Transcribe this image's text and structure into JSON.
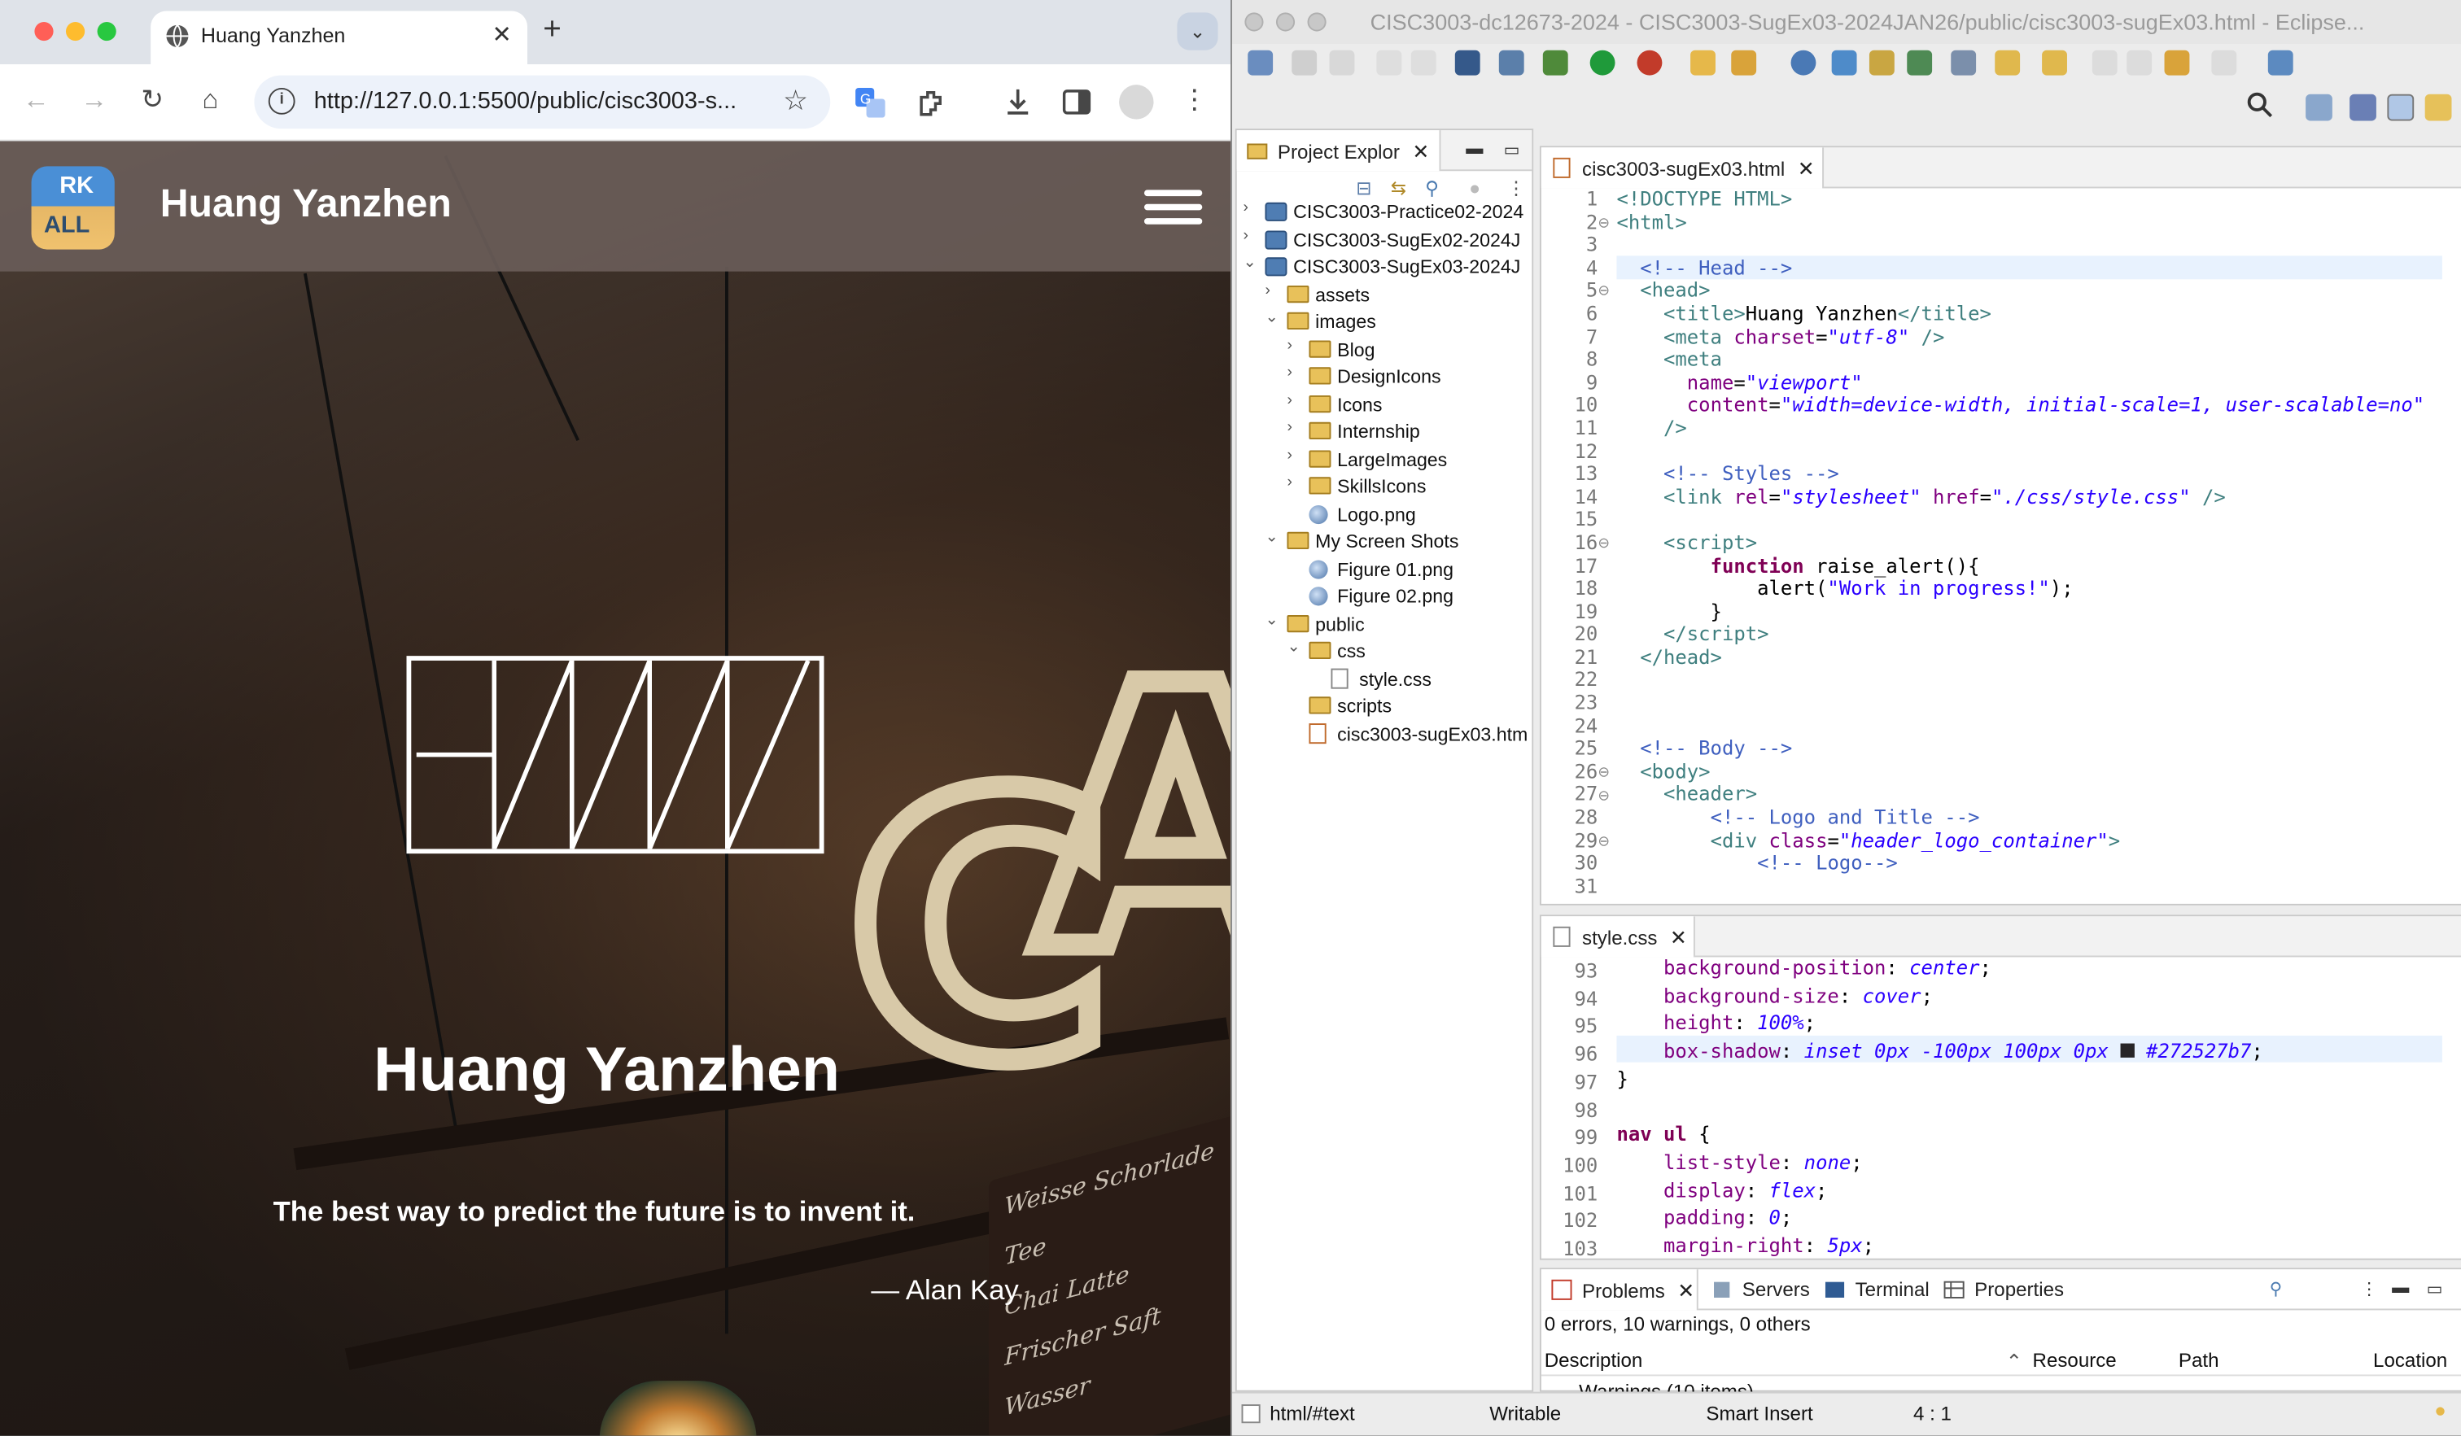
{
  "browser": {
    "tab_title": "Huang Yanzhen",
    "new_tab_symbol": "+",
    "url": "http://127.0.0.1:5500/public/cisc3003-s...",
    "page": {
      "site_title": "Huang Yanzhen",
      "logo_top": "RK",
      "logo_bottom": "ALL",
      "hero_name": "Huang Yanzhen",
      "quote": "The best way to predict the future is to invent it.",
      "author": "— Alan Kay"
    }
  },
  "eclipse": {
    "window_title": "CISC3003-dc12673-2024 - CISC3003-SugEx03-2024JAN26/public/cisc3003-sugEx03.html - Eclipse...",
    "explorer": {
      "tab_label": "Project Explor",
      "items": [
        {
          "label": "CISC3003-Practice02-2024",
          "kind": "project",
          "arrow": "›"
        },
        {
          "label": "CISC3003-SugEx02-2024J",
          "kind": "project",
          "arrow": "›"
        },
        {
          "label": "CISC3003-SugEx03-2024J",
          "kind": "project",
          "arrow": "⌄"
        },
        {
          "label": "assets",
          "kind": "folder",
          "arrow": "›"
        },
        {
          "label": "images",
          "kind": "folder",
          "arrow": "⌄"
        },
        {
          "label": "Blog",
          "kind": "folder",
          "arrow": "›"
        },
        {
          "label": "DesignIcons",
          "kind": "folder",
          "arrow": "›"
        },
        {
          "label": "Icons",
          "kind": "folder",
          "arrow": "›"
        },
        {
          "label": "Internship",
          "kind": "folder",
          "arrow": "›"
        },
        {
          "label": "LargeImages",
          "kind": "folder",
          "arrow": "›"
        },
        {
          "label": "SkillsIcons",
          "kind": "folder",
          "arrow": "›"
        },
        {
          "label": "Logo.png",
          "kind": "png",
          "arrow": ""
        },
        {
          "label": "My Screen Shots",
          "kind": "folder",
          "arrow": "⌄"
        },
        {
          "label": "Figure 01.png",
          "kind": "png",
          "arrow": ""
        },
        {
          "label": "Figure 02.png",
          "kind": "png",
          "arrow": ""
        },
        {
          "label": "public",
          "kind": "folder",
          "arrow": "⌄"
        },
        {
          "label": "css",
          "kind": "folder",
          "arrow": "⌄"
        },
        {
          "label": "style.css",
          "kind": "css",
          "arrow": ""
        },
        {
          "label": "scripts",
          "kind": "folder",
          "arrow": ""
        },
        {
          "label": "cisc3003-sugEx03.htm",
          "kind": "html",
          "arrow": ""
        }
      ]
    },
    "html_editor": {
      "tab_label": "cisc3003-sugEx03.html",
      "line_numbers": [
        "1",
        "2",
        "3",
        "4",
        "5",
        "6",
        "7",
        "8",
        "9",
        "10",
        "11",
        "12",
        "13",
        "14",
        "15",
        "16",
        "17",
        "18",
        "19",
        "20",
        "21",
        "22",
        "23",
        "24",
        "25",
        "26",
        "27",
        "28",
        "29",
        "30",
        "31"
      ],
      "fold_markers": [
        "2",
        "5",
        "16",
        "26",
        "27",
        "29"
      ]
    },
    "css_editor": {
      "tab_label": "style.css",
      "line_numbers": [
        "93",
        "94",
        "95",
        "96",
        "97",
        "98",
        "99",
        "100",
        "101",
        "102",
        "103"
      ]
    },
    "problems": {
      "tabs": [
        "Problems",
        "Servers",
        "Terminal",
        "Properties"
      ],
      "summary": "0 errors, 10 warnings, 0 others",
      "columns": [
        "Description",
        "Resource",
        "Path",
        "Location"
      ],
      "row": "Warnings (10 items)"
    },
    "status": {
      "path": "html/#text",
      "mode": "Writable",
      "insert": "Smart Insert",
      "position": "4 : 1"
    }
  }
}
